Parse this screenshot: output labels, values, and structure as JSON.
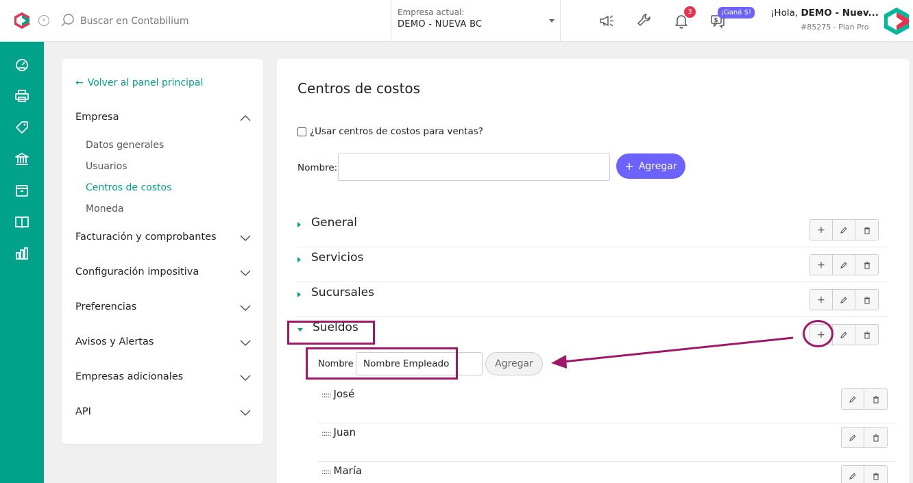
{
  "header": {
    "search_placeholder": "Buscar en Contabilium",
    "company_label": "Empresa actual:",
    "company_value": "DEMO - NUEVA BC",
    "notification_count": "3",
    "gana_badge": "¡Ganá $!",
    "greeting_prefix": "¡Hola, ",
    "greeting_name": "DEMO - Nuev...",
    "plan": "#85275 - Plan Pro"
  },
  "rail": {
    "icons": [
      "dashboard-icon",
      "printer-icon",
      "tag-icon",
      "bank-icon",
      "box-icon",
      "book-icon",
      "chart-icon"
    ]
  },
  "settings_nav": {
    "back_label": "Volver al panel principal",
    "sections": [
      {
        "label": "Empresa",
        "expanded": true,
        "items": [
          {
            "label": "Datos generales",
            "active": false
          },
          {
            "label": "Usuarios",
            "active": false
          },
          {
            "label": "Centros de costos",
            "active": true
          },
          {
            "label": "Moneda",
            "active": false
          }
        ]
      },
      {
        "label": "Facturación y comprobantes",
        "expanded": false
      },
      {
        "label": "Configuración impositiva",
        "expanded": false
      },
      {
        "label": "Preferencias",
        "expanded": false
      },
      {
        "label": "Avisos y Alertas",
        "expanded": false
      },
      {
        "label": "Empresas adicionales",
        "expanded": false
      },
      {
        "label": "API",
        "expanded": false
      }
    ]
  },
  "main": {
    "title": "Centros de costos",
    "use_for_sales_label": "¿Usar centros de costos para ventas?",
    "use_for_sales_checked": false,
    "name_label": "Nombre:",
    "name_value": "",
    "add_label": "Agregar",
    "add_plus": "+",
    "cost_centers": [
      {
        "name": "General",
        "expanded": false
      },
      {
        "name": "Servicios",
        "expanded": false
      },
      {
        "name": "Sucursales",
        "expanded": false
      },
      {
        "name": "Sueldos",
        "expanded": true
      }
    ],
    "sub_form": {
      "label": "Nombre",
      "value": "Nombre Empleado",
      "add_label": "Agregar"
    },
    "employees": [
      {
        "drag": ":::::",
        "name": "José"
      },
      {
        "drag": ":::::",
        "name": "Juan"
      },
      {
        "drag": ":::::",
        "name": "María"
      }
    ],
    "row_buttons": {
      "add": "+"
    }
  },
  "colors": {
    "brand_green": "#00a28a",
    "accent_purple": "#6c63ff",
    "annotation": "#a0176a",
    "badge_red": "#e8334f"
  }
}
